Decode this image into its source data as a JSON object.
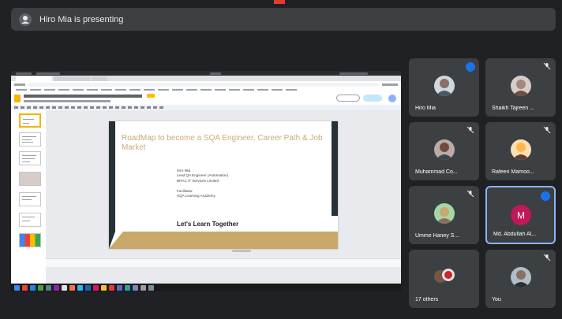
{
  "banner": {
    "text": "Hiro Mia is presenting",
    "icon": "presenter-avatar-icon"
  },
  "slide": {
    "title": "RoadMap to become a SQA Engineer, Career Path & Job Market",
    "info_lines": [
      "Hiro Mia",
      "Lead QA Engineer (Automation)",
      "BRAC IT Services Limited",
      "",
      "Facilitator",
      "SQA Learning Academy"
    ],
    "tagline": "Let's Learn Together"
  },
  "participants": [
    {
      "name": "Hiro Mia",
      "state": "speaking",
      "avatar": "photo-man-icon",
      "color": "#8d6e63"
    },
    {
      "name": "Shaikh Tajreen ...",
      "state": "muted",
      "avatar": "photo-woman-icon",
      "color": "#a1887f"
    },
    {
      "name": "Muhammad Co...",
      "state": "muted",
      "avatar": "photo-man-icon",
      "color": "#6d4c41"
    },
    {
      "name": "Rafeen Mamoo...",
      "state": "muted",
      "avatar": "photo-man-icon",
      "color": "#ffb74d"
    },
    {
      "name": "Umme Haney S...",
      "state": "muted",
      "avatar": "photo-woman-icon",
      "color": "#c8a96e"
    },
    {
      "name": "Md. Abdullah Al...",
      "state": "speaking",
      "avatar": "letter-avatar",
      "letter": "M",
      "color": "#c2185b"
    },
    {
      "name": "17 others",
      "state": "none",
      "avatar": "group-icon",
      "color": "#795548"
    },
    {
      "name": "You",
      "state": "muted",
      "avatar": "photo-man-icon",
      "color": "#8d6e63"
    }
  ],
  "colors": {
    "background": "#202124",
    "tile": "#3c4043",
    "accent": "#8ab4f8",
    "speaking": "#1a73e8"
  }
}
